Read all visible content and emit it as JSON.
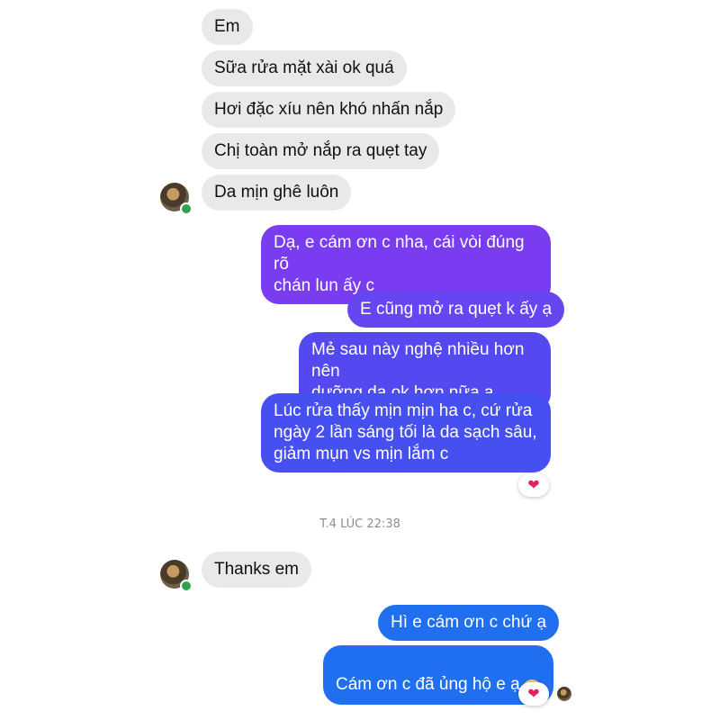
{
  "conversation": {
    "messages_in_1": [
      {
        "text": "Em"
      },
      {
        "text": "Sữa rửa mặt xài ok quá"
      },
      {
        "text": "Hơi đặc xíu nên khó nhấn nắp"
      },
      {
        "text": "Chị toàn mở nắp ra quẹt tay"
      },
      {
        "text": "Da mịn ghê luôn"
      }
    ],
    "messages_out_1": [
      {
        "text": "Dạ, e cám ơn c nha, cái vòi đúng rõ\nchán lun ấy c"
      },
      {
        "text": "E cũng mở ra quẹt k ấy ạ"
      },
      {
        "text": "Mẻ sau này nghệ nhiều hơn nên\ndưỡng da ok hơn nữa ạ"
      },
      {
        "text": "Lúc rửa thấy mịn mịn ha c, cứ rửa\nngày 2 lần sáng tối là da sạch sâu,\ngiảm mụn vs mịn lắm c"
      }
    ],
    "timestamp": "T.4 LÚC 22:38",
    "messages_in_2": [
      {
        "text": "Thanks em"
      }
    ],
    "messages_out_2": [
      {
        "text": "Hì e cám ơn c chứ ạ"
      },
      {
        "text": "Cám ơn c đã ủng hộ e ạ"
      }
    ],
    "reactions": [
      "heart",
      "heart"
    ],
    "icons": {
      "reaction": "heart-icon",
      "emoji": "smiling-face-emoji",
      "presence": "online-dot"
    }
  },
  "colors": {
    "incoming_bubble": "#e9e9ec",
    "outgoing_gradient": [
      "#7b3cf2",
      "#4a4df2",
      "#1f6ff0"
    ],
    "online": "#31a24c",
    "heart": "#e0245e"
  }
}
